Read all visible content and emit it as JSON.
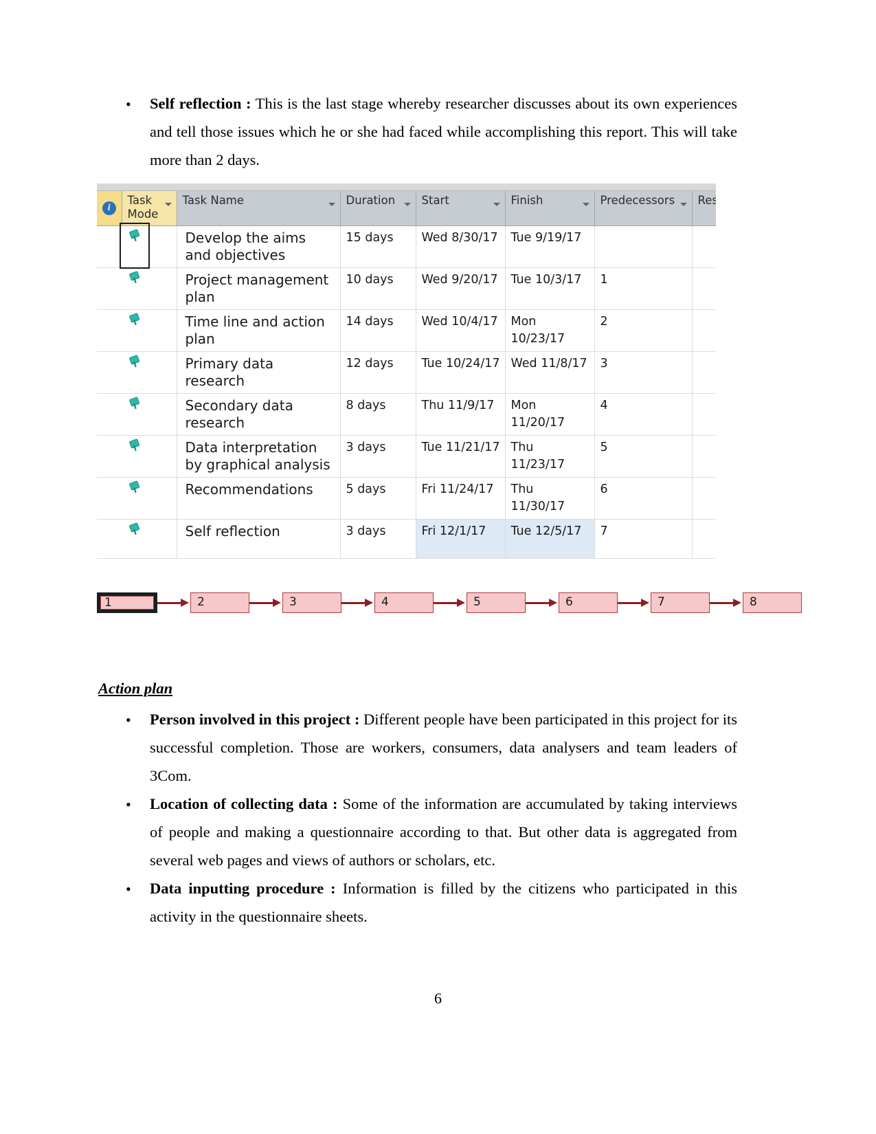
{
  "document": {
    "page_number": "6",
    "top_bullets": [
      {
        "lead": "Self reflection :",
        "text": " This is the last stage whereby researcher discusses about its own experiences and tell those issues which he or she had faced while accomplishing this report. This will take more than 2 days."
      }
    ],
    "section": {
      "heading": "Action plan ",
      "bullets": [
        {
          "lead": "Person involved in this project :",
          "text": " Different people have been participated in this project for its successful completion. Those are workers, consumers, data analysers and team leaders of 3Com."
        },
        {
          "lead": "Location of collecting data :",
          "text": " Some of the information are accumulated by taking interviews of people and making a questionnaire according to that. But other data is aggregated from several web pages and views of authors or scholars, etc."
        },
        {
          "lead": "Data inputting procedure :",
          "text": " Information is filled by the citizens who participated in this activity in the questionnaire sheets."
        }
      ]
    }
  },
  "gantt": {
    "columns": [
      {
        "key": "info",
        "label": "i"
      },
      {
        "key": "mode",
        "label": "Task Mode"
      },
      {
        "key": "name",
        "label": "Task Name"
      },
      {
        "key": "duration",
        "label": "Duration"
      },
      {
        "key": "start",
        "label": "Start"
      },
      {
        "key": "finish",
        "label": "Finish"
      },
      {
        "key": "predecessors",
        "label": "Predecessors"
      },
      {
        "key": "resource",
        "label": "Reso"
      }
    ],
    "rows": [
      {
        "name": "Develop the aims and objectives",
        "duration": "15 days",
        "start": "Wed 8/30/17",
        "finish": "Tue 9/19/17",
        "predecessors": ""
      },
      {
        "name": "Project management plan",
        "duration": "10 days",
        "start": "Wed 9/20/17",
        "finish": "Tue 10/3/17",
        "predecessors": "1"
      },
      {
        "name": "Time line and action plan",
        "duration": "14 days",
        "start": "Wed 10/4/17",
        "finish": "Mon 10/23/17",
        "predecessors": "2"
      },
      {
        "name": "Primary data research",
        "duration": "12 days",
        "start": "Tue 10/24/17",
        "finish": "Wed 11/8/17",
        "predecessors": "3"
      },
      {
        "name": "Secondary data research",
        "duration": "8 days",
        "start": "Thu 11/9/17",
        "finish": "Mon 11/20/17",
        "predecessors": "4"
      },
      {
        "name": "Data interpretation by graphical analysis",
        "duration": "3 days",
        "start": "Tue 11/21/17",
        "finish": "Thu 11/23/17",
        "predecessors": "5"
      },
      {
        "name": "Recommendations",
        "duration": "5 days",
        "start": "Fri 11/24/17",
        "finish": "Thu 11/30/17",
        "predecessors": "6"
      },
      {
        "name": "Self reflection",
        "duration": "3 days",
        "start": "Fri 12/1/17",
        "finish": "Tue 12/5/17",
        "predecessors": "7",
        "selected": true
      }
    ],
    "colors": {
      "header_bg": "#c7ccd3",
      "mode_header_bg": "#f5e6a8",
      "info_header_bg": "#f5dc8a",
      "selection_bg": "#dde9f4",
      "pin_icon": "#2fb9ab"
    }
  },
  "network_diagram": {
    "nodes": [
      "1",
      "2",
      "3",
      "4",
      "5",
      "6",
      "7",
      "8"
    ],
    "colors": {
      "box_fill": "#f7c8ca",
      "box_border": "#b03a3f",
      "arrow": "#8e1e22",
      "selected_outline": "#17211d"
    }
  }
}
